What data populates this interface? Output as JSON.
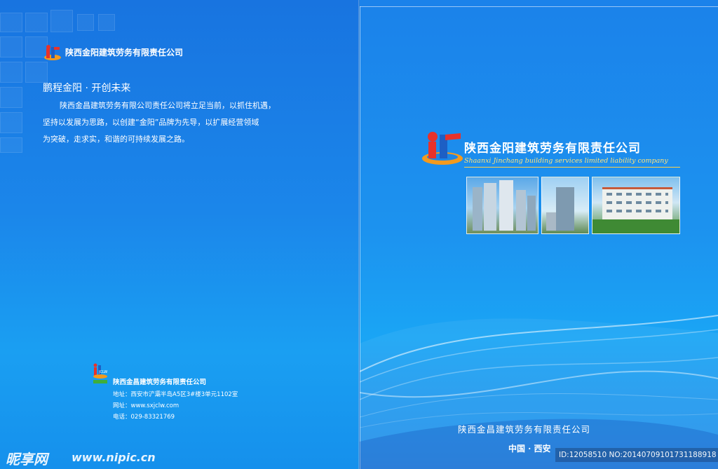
{
  "left": {
    "header_company": "陕西金阳建筑劳务有限责任公司",
    "slogan": "鹏程金阳 · 开创未来",
    "paragraph_lines": [
      "陕西金昌建筑劳务有限公司责任公司将立足当前，以抓住机遇，",
      "坚持以发展为思路，以创建“金阳”品牌为先导，以扩展经营领域",
      "为突破，走求实，和谐的可持续发展之路。"
    ],
    "footer": {
      "company": "陕西金昌建筑劳务有限责任公司",
      "address": "地址：西安市浐灞半岛A5区3#楼3单元1102室",
      "website": "网址：www.sxjclw.com",
      "phone": "电话：029-83321769",
      "logo_text": "JCLW"
    }
  },
  "right": {
    "company_cn": "陕西金阳建筑劳务有限责任公司",
    "company_en": "Shaanxi Jinchang building services limited liability company",
    "photos": [
      "skyscrapers-photo",
      "office-tower-photo",
      "residential-building-photo"
    ],
    "bottom_company": "陕西金昌建筑劳务有限责任公司",
    "bottom_location": "中国 · 西安"
  },
  "watermark": {
    "site_logo": "昵享网",
    "site_url": "www.nipic.cn",
    "id_text": "ID:12058510 NO:20140709101731188918"
  },
  "colors": {
    "background_blue": "#1c86e6",
    "logo_red": "#e8322a",
    "logo_blue": "#1d5fc4",
    "logo_orange": "#f39a1e"
  }
}
